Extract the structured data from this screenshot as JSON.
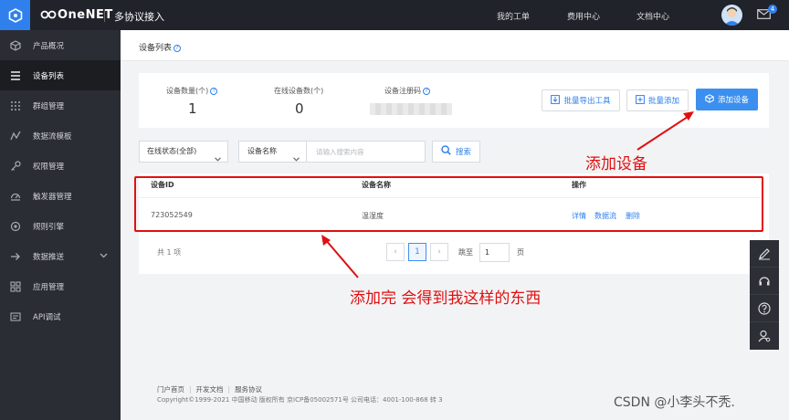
{
  "topbar": {
    "brand": "OneNET",
    "product": "多协议接入",
    "nav": [
      "我的工单",
      "费用中心",
      "文档中心"
    ],
    "mail_badge": "4"
  },
  "sidebar": {
    "items": [
      {
        "label": "产品概况",
        "icon": "cube-icon"
      },
      {
        "label": "设备列表",
        "icon": "list-icon",
        "active": true
      },
      {
        "label": "群组管理",
        "icon": "grid-dots-icon"
      },
      {
        "label": "数据流模板",
        "icon": "stream-icon"
      },
      {
        "label": "权限管理",
        "icon": "key-icon"
      },
      {
        "label": "触发器管理",
        "icon": "trigger-icon"
      },
      {
        "label": "规则引擎",
        "icon": "rule-icon"
      },
      {
        "label": "数据推送",
        "icon": "push-icon"
      },
      {
        "label": "应用管理",
        "icon": "apps-icon"
      },
      {
        "label": "API调试",
        "icon": "api-icon"
      }
    ]
  },
  "page": {
    "title": "设备列表"
  },
  "stats": {
    "device_count_label": "设备数量(个)",
    "device_count_value": "1",
    "online_count_label": "在线设备数(个)",
    "online_count_value": "0",
    "register_code_label": "设备注册码"
  },
  "actions": {
    "batch_export": "批量导出工具",
    "batch_add": "批量添加",
    "add_device": "添加设备"
  },
  "filters": {
    "status_select": "在线状态(全部)",
    "field_select": "设备名称",
    "search_placeholder": "请输入搜索内容",
    "search_button": "搜索"
  },
  "table": {
    "headers": [
      "设备ID",
      "设备名称",
      "操作"
    ],
    "rows": [
      {
        "id": "723052549",
        "name": "温湿度",
        "ops": [
          "详情",
          "数据流",
          "删除"
        ]
      }
    ]
  },
  "pager": {
    "total": "共 1 项",
    "current_page": "1",
    "prev": "‹",
    "next": "›",
    "jump_label": "跳至",
    "jump_value": "1",
    "page_suffix": "页"
  },
  "annotations": {
    "add_device_note": "添加设备",
    "result_note": "添加完 会得到我这样的东西"
  },
  "footer": {
    "links": [
      "门户首页",
      "开发文档",
      "服务协议"
    ],
    "copyright": "Copyright©1999-2021 中国移动 版权所有 京ICP备05002571号 公司电话：4001-100-868 转 3"
  },
  "watermark": "CSDN @小李头不秃.",
  "colors": {
    "accent": "#3b8fef",
    "topbar": "#20232a",
    "sidebar": "#2a2d33",
    "annotation_red": "#e01010"
  }
}
